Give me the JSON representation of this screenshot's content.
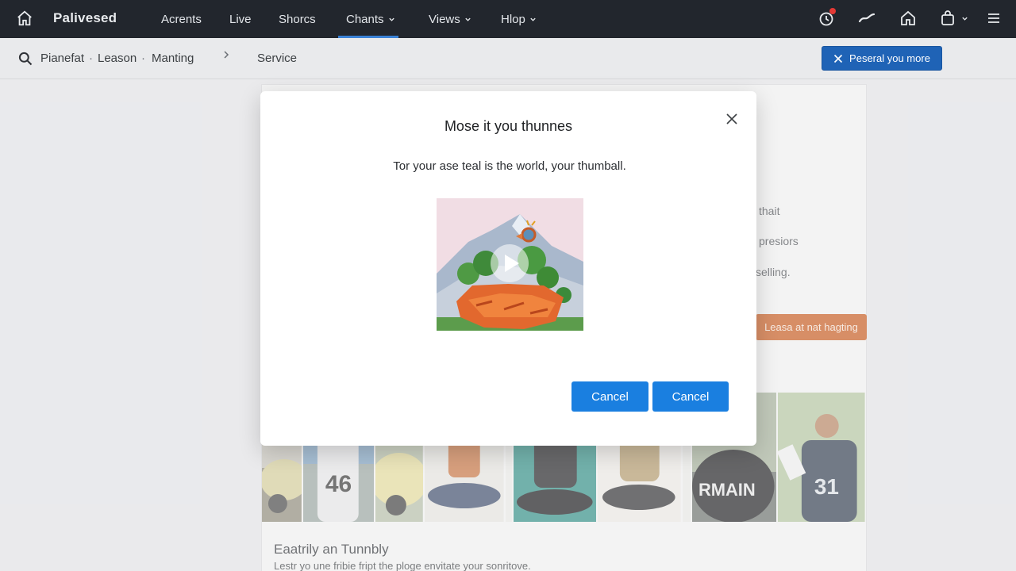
{
  "topbar": {
    "brand": "Palivesed",
    "nav": [
      {
        "label": "Acrents"
      },
      {
        "label": "Live"
      },
      {
        "label": "Shorcs"
      },
      {
        "label": "Chants"
      },
      {
        "label": "Views"
      },
      {
        "label": "Hlop"
      }
    ],
    "active_nav": "Chants",
    "icons": [
      "home-icon",
      "notification-icon",
      "trending-icon",
      "home-outline-icon",
      "shopping-bag-icon",
      "menu-icon"
    ]
  },
  "breadcrumb": {
    "items": [
      "Pianefat",
      "Leason",
      "Manting"
    ],
    "separator": "·",
    "current": "Service",
    "cta_label": "Peseral you more"
  },
  "background": {
    "side_texts": [
      "thait",
      "presiors",
      "selling."
    ],
    "side_button": "Leasa at nat hagting",
    "section_title": "Eaatrily an Tunnbly",
    "section_sub": "Lestr yo une fribie fript the ploge envitate your sonritove."
  },
  "modal": {
    "title": "Mose it you thunnes",
    "message": "Tor your ase teal is the world, your thumball.",
    "button_primary": "Cancel",
    "button_secondary": "Cancel"
  },
  "colors": {
    "topbar_bg": "#22262d",
    "accent": "#1a7fe0",
    "cta_bg": "#1f63b6",
    "orange": "#c95a1c"
  }
}
